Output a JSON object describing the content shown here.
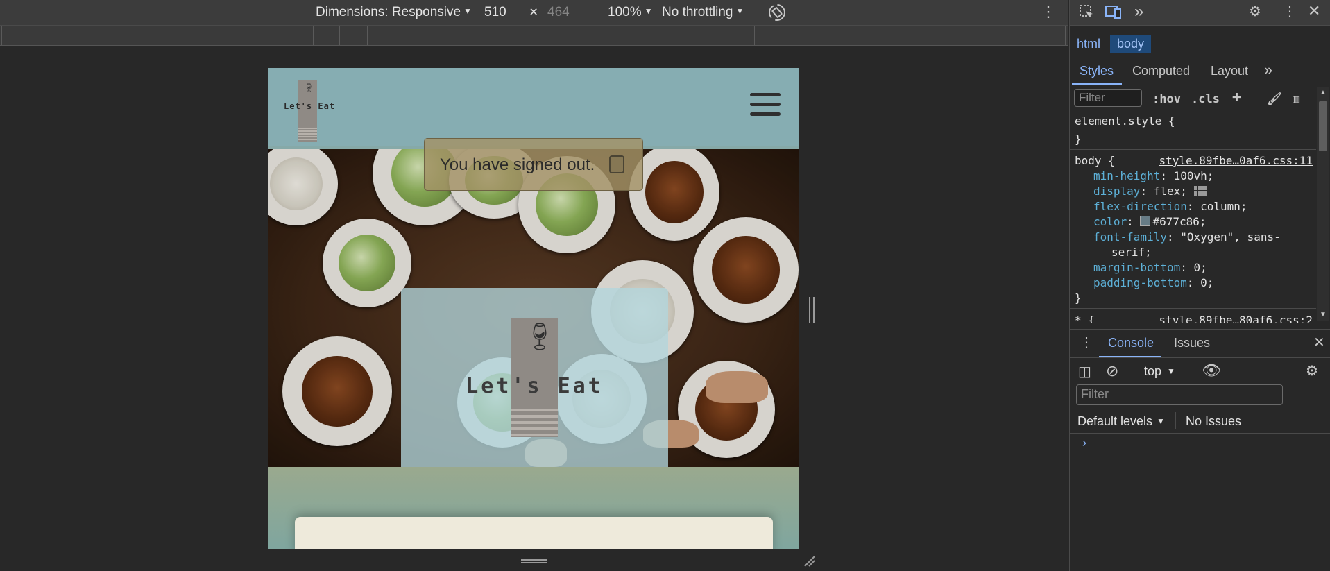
{
  "device_toolbar": {
    "dimensions_label": "Dimensions: Responsive",
    "width_value": "510",
    "times": "×",
    "height_value": "464",
    "zoom_label": "100%",
    "throttle_label": "No throttling"
  },
  "site": {
    "logo_text": "Let's Eat",
    "hero_logo_text": "Let's Eat",
    "toast_message": "You have signed out."
  },
  "devtools": {
    "breadcrumbs": [
      "html",
      "body"
    ],
    "tabs": [
      "Styles",
      "Computed",
      "Layout"
    ],
    "filter_placeholder": "Filter",
    "hov": ":hov",
    "cls": ".cls",
    "element_style": "element.style {",
    "close_brace": "}",
    "body_selector": "body {",
    "body_source": "style.89fbe…0af6.css:11",
    "rules": [
      {
        "prop": "min-height",
        "value": "100vh;"
      },
      {
        "prop": "display",
        "value": "flex;"
      },
      {
        "prop": "flex-direction",
        "value": "column;"
      },
      {
        "prop": "color",
        "value": "#677c86;"
      },
      {
        "prop": "font-family",
        "value": "\"Oxygen\", sans-"
      },
      {
        "prop": "",
        "value": "serif;"
      },
      {
        "prop": "margin-bottom",
        "value": "0;"
      },
      {
        "prop": "padding-bottom",
        "value": "0;"
      }
    ],
    "star_selector": "* {",
    "star_source": "style.89fbe…80af6.css:2",
    "drawer_tabs": [
      "Console",
      "Issues"
    ],
    "context": "top",
    "console_filter_placeholder": "Filter",
    "default_levels": "Default levels",
    "no_issues": "No Issues",
    "prompt": "›"
  }
}
